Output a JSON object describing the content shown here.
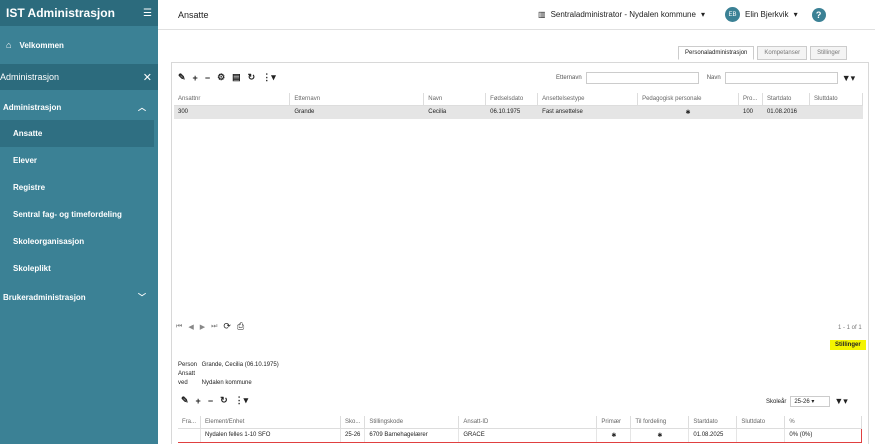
{
  "app": {
    "title": "IST Administrasjon"
  },
  "sidebar": {
    "home_label": "Velkommen",
    "section_label": "Administrasjon",
    "group_label": "Administrasjon",
    "items": [
      {
        "label": "Ansatte"
      },
      {
        "label": "Elever"
      },
      {
        "label": "Registre"
      },
      {
        "label": "Sentral fag- og timefordeling"
      },
      {
        "label": "Skoleorganisasjon"
      },
      {
        "label": "Skoleplikt"
      }
    ],
    "group2_label": "Brukeradministrasjon"
  },
  "header": {
    "page_title": "Ansatte",
    "org": "Sentraladministrator - Nydalen kommune",
    "user_initials": "EB",
    "user_name": "Elin Bjerkvik",
    "help": "?"
  },
  "tabs": [
    {
      "label": "Personaladministrasjon"
    },
    {
      "label": "Kompetanser"
    },
    {
      "label": "Stillinger"
    }
  ],
  "filters": {
    "etternavn_label": "Etternavn",
    "navn_label": "Navn"
  },
  "employees": {
    "columns": [
      "Ansattnr",
      "Etternavn",
      "Navn",
      "Fødselsdato",
      "Ansettelsestype",
      "Pedagogisk personale",
      "Pro...",
      "Startdato",
      "Sluttdato"
    ],
    "rows": [
      {
        "ansattnr": "300",
        "etternavn": "Grande",
        "navn": "Cecilia",
        "fodselsdato": "06.10.1975",
        "type": "Fast ansettelse",
        "ped": "✱",
        "pro": "100",
        "start": "01.08.2016",
        "slutt": ""
      }
    ]
  },
  "pager": {
    "count": "1 - 1 of 1"
  },
  "stillinger_badge": "Stillinger",
  "detail": {
    "person_label": "Person",
    "person_value": "Grande, Cecilia (06.10.1975)",
    "ansatt_label": "Ansatt ved",
    "ansatt_value": "Nydalen kommune"
  },
  "skolear": {
    "label": "Skoleår",
    "value": "25-26"
  },
  "positions": {
    "columns": [
      "Fra...",
      "Element/Enhet",
      "Sko...",
      "Stillingskode",
      "Ansatt-ID",
      "Primær",
      "Til fordeling",
      "Startdato",
      "Sluttdato",
      "%"
    ],
    "rows": [
      {
        "fra": "",
        "element": "Nydalen felles 1-10 SFO",
        "sko": "25-26",
        "kode": "6709 Barnehagelærer",
        "id": "GRACE",
        "primaer": "✱",
        "til": "✱",
        "start": "01.08.2025",
        "slutt": "",
        "pct": "0% (0%)"
      }
    ]
  }
}
